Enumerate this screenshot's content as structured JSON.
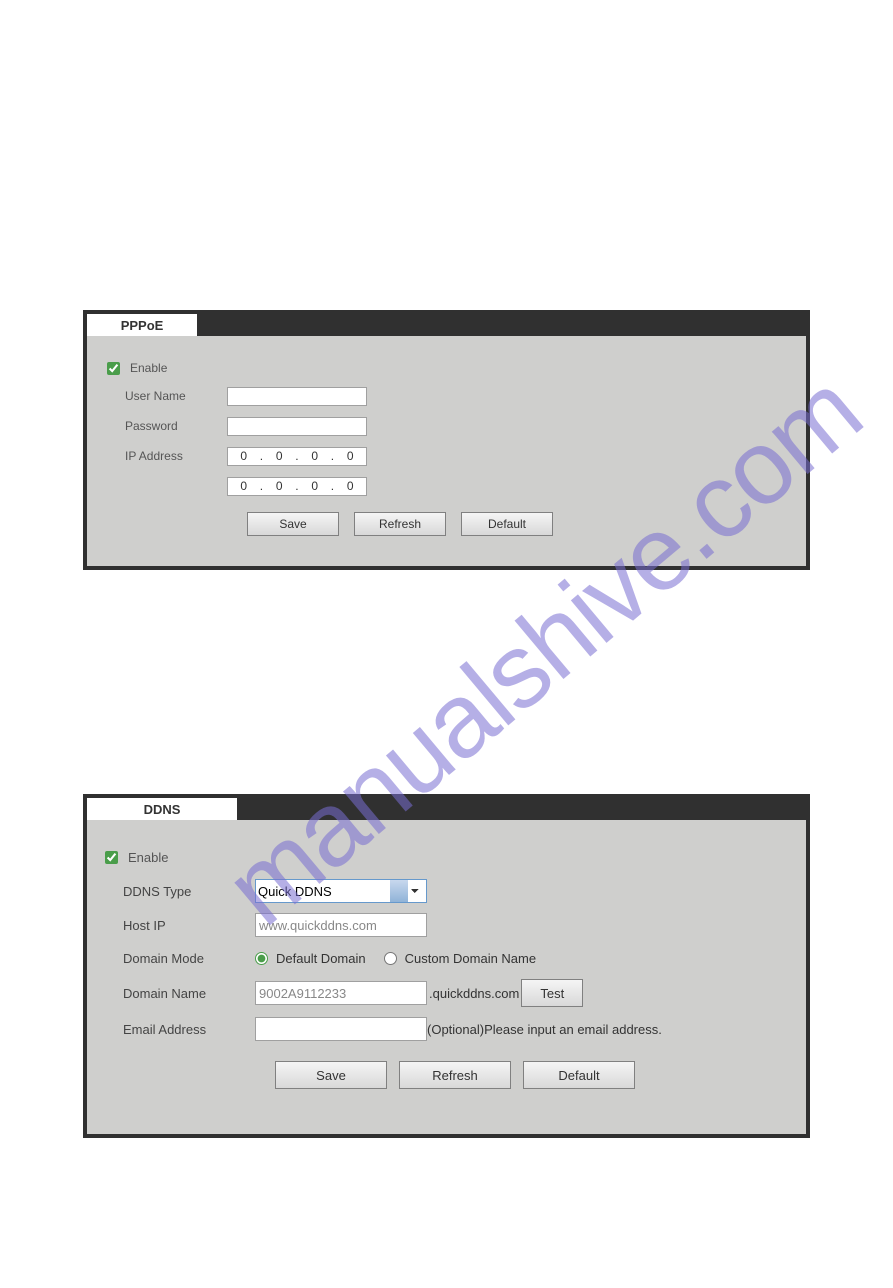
{
  "pppoe": {
    "tab_label": "PPPoE",
    "enable_label": "Enable",
    "enable_checked": true,
    "username_label": "User Name",
    "username_value": "",
    "password_label": "Password",
    "password_value": "",
    "ipaddress_label": "IP Address",
    "ip1": {
      "a": "0",
      "b": "0",
      "c": "0",
      "d": "0"
    },
    "ip2": {
      "a": "0",
      "b": "0",
      "c": "0",
      "d": "0"
    },
    "save_label": "Save",
    "refresh_label": "Refresh",
    "default_label": "Default"
  },
  "ddns": {
    "tab_label": "DDNS",
    "enable_label": "Enable",
    "enable_checked": true,
    "ddns_type_label": "DDNS Type",
    "ddns_type_value": "Quick DDNS",
    "host_ip_label": "Host IP",
    "host_ip_value": "www.quickddns.com",
    "domain_mode_label": "Domain Mode",
    "radio_default_label": "Default Domain",
    "radio_custom_label": "Custom Domain Name",
    "domain_mode_selected": "default",
    "domain_name_label": "Domain Name",
    "domain_name_value": "9002A9112233",
    "domain_suffix": ".quickddns.com",
    "test_label": "Test",
    "email_label": "Email Address",
    "email_value": "",
    "email_hint": "(Optional)Please input an email address.",
    "save_label": "Save",
    "refresh_label": "Refresh",
    "default_label": "Default"
  },
  "watermark": "manualshive.com"
}
